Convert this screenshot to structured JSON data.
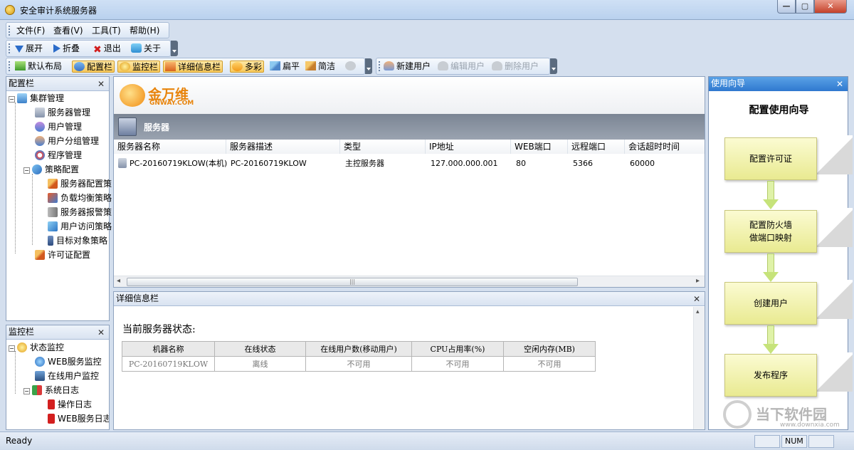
{
  "window": {
    "title": "安全审计系统服务器"
  },
  "menu": {
    "file": "文件(F)",
    "view": "查看(V)",
    "tools": "工具(T)",
    "help": "帮助(H)"
  },
  "toolbar1": {
    "expand": "展开",
    "collapse": "折叠",
    "exit": "退出",
    "about": "关于"
  },
  "toolbar2": {
    "default_layout": "默认布局",
    "config_bar": "配置栏",
    "monitor_bar": "监控栏",
    "detail_bar": "详细信息栏",
    "colorful": "多彩",
    "flat": "扁平",
    "simple": "简洁"
  },
  "toolbar3": {
    "new_user": "新建用户",
    "edit_user": "编辑用户",
    "delete_user": "删除用户"
  },
  "config_panel": {
    "title": "配置栏",
    "items": [
      "集群管理",
      "服务器管理",
      "用户管理",
      "用户分组管理",
      "程序管理",
      "策略配置",
      "服务器配置策",
      "负载均衡策略",
      "服务器报警策",
      "用户访问策略",
      "目标对象策略",
      "许可证配置"
    ]
  },
  "monitor_panel": {
    "title": "监控栏",
    "items": [
      "状态监控",
      "WEB服务监控",
      "在线用户监控",
      "系统日志",
      "操作日志",
      "WEB服务日志"
    ]
  },
  "brand": {
    "name_cn": "金万维",
    "name_en": "GNWAY.COM"
  },
  "server_section": {
    "title": "服务器",
    "columns": [
      "服务器名称",
      "服务器描述",
      "类型",
      "IP地址",
      "WEB端口",
      "远程端口",
      "会话超时时间"
    ],
    "rows": [
      [
        "PC-20160719KLOW(本机)",
        "PC-20160719KLOW",
        "主控服务器",
        "127.000.000.001",
        "80",
        "5366",
        "60000"
      ]
    ]
  },
  "detail_panel": {
    "title": "详细信息栏",
    "status_heading": "当前服务器状态:",
    "columns": [
      "机器名称",
      "在线状态",
      "在线用户数(移动用户)",
      "CPU占用率(%)",
      "空闲内存(MB)"
    ],
    "row": [
      "PC-20160719KLOW",
      "离线",
      "不可用",
      "不可用",
      "不可用"
    ]
  },
  "wizard": {
    "title": "使用向导",
    "heading": "配置使用向导",
    "steps": [
      "配置许可证",
      "配置防火墙\n做端口映射",
      "创建用户",
      "发布程序"
    ]
  },
  "watermark": {
    "text": "当下软件园",
    "url": "www.downxia.com"
  },
  "status_bar": {
    "ready": "Ready",
    "num": "NUM"
  }
}
